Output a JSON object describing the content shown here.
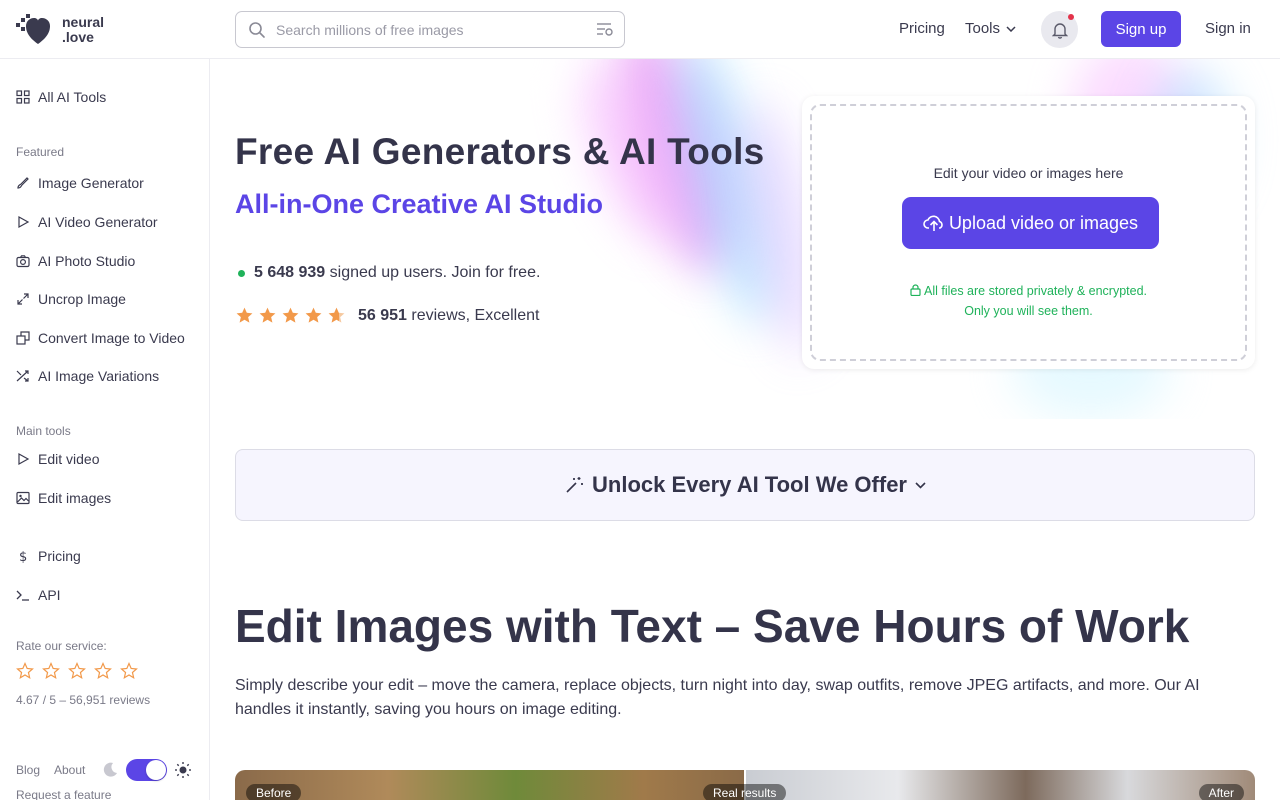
{
  "header": {
    "logo_text_line1": "neural",
    "logo_text_line2": ".love",
    "search_placeholder": "Search millions of free images",
    "nav_pricing": "Pricing",
    "nav_tools": "Tools",
    "signup_label": "Sign up",
    "signin_label": "Sign in"
  },
  "sidebar": {
    "all_tools": "All AI Tools",
    "featured_label": "Featured",
    "featured": [
      {
        "label": "Image Generator",
        "icon": "brush-icon"
      },
      {
        "label": "AI Video Generator",
        "icon": "play-icon"
      },
      {
        "label": "AI Photo Studio",
        "icon": "camera-icon"
      },
      {
        "label": "Uncrop Image",
        "icon": "expand-icon"
      },
      {
        "label": "Convert Image to Video",
        "icon": "convert-icon"
      },
      {
        "label": "AI Image Variations",
        "icon": "shuffle-icon"
      }
    ],
    "main_label": "Main tools",
    "main": [
      {
        "label": "Edit video",
        "icon": "play-icon"
      },
      {
        "label": "Edit images",
        "icon": "image-icon"
      }
    ],
    "pricing": "Pricing",
    "api": "API",
    "rate_label": "Rate our service:",
    "rate_summary": "4.67 / 5 – 56,951 reviews",
    "blog": "Blog",
    "about": "About",
    "request": "Request a feature"
  },
  "hero": {
    "title": "Free AI Generators & AI Tools",
    "subtitle": "All-in-One Creative AI Studio",
    "users_count": "5 648 939",
    "users_text": "signed up users. Join for free.",
    "review_stars": 4.67,
    "reviews_count": "56 951",
    "reviews_text": "reviews, Excellent"
  },
  "upload": {
    "hint": "Edit your video or images here",
    "button": "Upload video or images",
    "privacy_line1": "All files are stored privately & encrypted.",
    "privacy_line2": "Only you will see them."
  },
  "unlock": {
    "label": "Unlock Every AI Tool We Offer"
  },
  "section": {
    "title": "Edit Images with Text – Save Hours of Work",
    "description": "Simply describe your edit – move the camera, replace objects, turn night into day, swap outfits, remove JPEG artifacts, and more. Our AI handles it instantly, saving you hours on image editing."
  },
  "compare": {
    "before": "Before",
    "middle": "Real results",
    "after": "After"
  },
  "colors": {
    "accent": "#5b45e6",
    "success": "#1fb25a",
    "star": "#f2994a",
    "notification": "#e3334a"
  }
}
